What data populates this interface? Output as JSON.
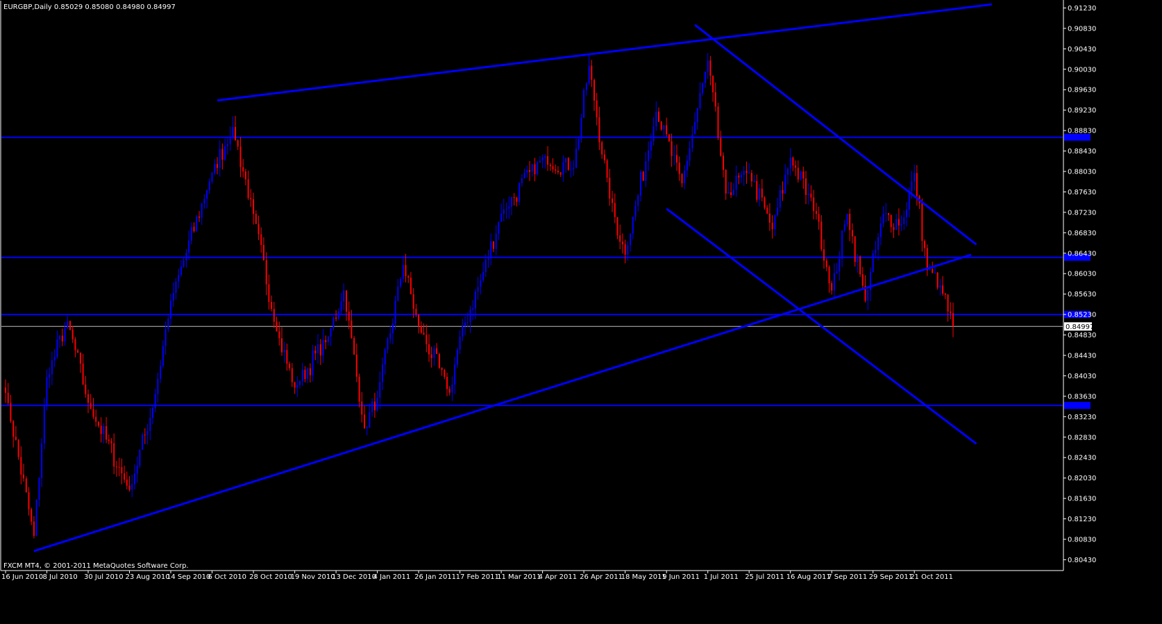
{
  "window": {
    "symbol_header": "EURGBP,Daily  0.85029 0.85080 0.84980 0.84997",
    "copyright": "FXCM MT4, © 2001-2011 MetaQuotes Software Corp."
  },
  "chart_data": {
    "type": "candlestick",
    "symbol": "EURGBP",
    "timeframe": "Daily",
    "ohlc_last": {
      "open": 0.85029,
      "high": 0.8508,
      "low": 0.8498,
      "close": 0.84997
    },
    "current_price_label": "0.84997",
    "ylim": [
      0.803,
      0.9133
    ],
    "y_ticks": [
      "0.91230",
      "0.90830",
      "0.90430",
      "0.90030",
      "0.89630",
      "0.89230",
      "0.88830",
      "0.88430",
      "0.88030",
      "0.87630",
      "0.87230",
      "0.86830",
      "0.86430",
      "0.86030",
      "0.85630",
      "0.85230",
      "0.84830",
      "0.84430",
      "0.84030",
      "0.83630",
      "0.83230",
      "0.82830",
      "0.82430",
      "0.82030",
      "0.81630",
      "0.81230",
      "0.80830",
      "0.80430"
    ],
    "x_labels": [
      "16 Jun 2010",
      "8 Jul 2010",
      "30 Jul 2010",
      "23 Aug 2010",
      "14 Sep 2010",
      "6 Oct 2010",
      "28 Oct 2010",
      "19 Nov 2010",
      "13 Dec 2010",
      "4 Jan 2011",
      "26 Jan 2011",
      "17 Feb 2011",
      "11 Mar 2011",
      "4 Apr 2011",
      "26 Apr 2011",
      "18 May 2011",
      "9 Jun 2011",
      "1 Jul 2011",
      "25 Jul 2011",
      "16 Aug 2011",
      "7 Sep 2011",
      "29 Sep 2011",
      "21 Oct 2011"
    ],
    "key_closes": [
      {
        "date": "16 Jun 2010",
        "close": 0.837
      },
      {
        "date": "1 Jul 2010",
        "close": 0.809
      },
      {
        "date": "8 Jul 2010",
        "close": 0.84
      },
      {
        "date": "20 Jul 2010",
        "close": 0.851
      },
      {
        "date": "30 Jul 2010",
        "close": 0.835
      },
      {
        "date": "23 Aug 2010",
        "close": 0.818
      },
      {
        "date": "5 Sep 2010",
        "close": 0.834
      },
      {
        "date": "14 Sep 2010",
        "close": 0.855
      },
      {
        "date": "6 Oct 2010",
        "close": 0.88
      },
      {
        "date": "18 Oct 2010",
        "close": 0.889
      },
      {
        "date": "28 Oct 2010",
        "close": 0.872
      },
      {
        "date": "10 Nov 2010",
        "close": 0.849
      },
      {
        "date": "19 Nov 2010",
        "close": 0.838
      },
      {
        "date": "8 Dec 2010",
        "close": 0.848
      },
      {
        "date": "16 Dec 2010",
        "close": 0.857
      },
      {
        "date": "28 Dec 2010",
        "close": 0.83
      },
      {
        "date": "4 Jan 2011",
        "close": 0.836
      },
      {
        "date": "18 Jan 2011",
        "close": 0.862
      },
      {
        "date": "26 Jan 2011",
        "close": 0.85
      },
      {
        "date": "12 Feb 2011",
        "close": 0.837
      },
      {
        "date": "17 Feb 2011",
        "close": 0.848
      },
      {
        "date": "1 Mar 2011",
        "close": 0.859
      },
      {
        "date": "11 Mar 2011",
        "close": 0.872
      },
      {
        "date": "4 Apr 2011",
        "close": 0.883
      },
      {
        "date": "20 Apr 2011",
        "close": 0.881
      },
      {
        "date": "28 Apr 2011",
        "close": 0.901
      },
      {
        "date": "10 May 2011",
        "close": 0.875
      },
      {
        "date": "18 May 2011",
        "close": 0.864
      },
      {
        "date": "5 Jun 2011",
        "close": 0.892
      },
      {
        "date": "17 Jun 2011",
        "close": 0.878
      },
      {
        "date": "1 Jul 2011",
        "close": 0.902
      },
      {
        "date": "12 Jul 2011",
        "close": 0.876
      },
      {
        "date": "25 Jul 2011",
        "close": 0.88
      },
      {
        "date": "5 Aug 2011",
        "close": 0.869
      },
      {
        "date": "16 Aug 2011",
        "close": 0.883
      },
      {
        "date": "30 Aug 2011",
        "close": 0.872
      },
      {
        "date": "7 Sep 2011",
        "close": 0.857
      },
      {
        "date": "15 Sep 2011",
        "close": 0.872
      },
      {
        "date": "26 Sep 2011",
        "close": 0.855
      },
      {
        "date": "5 Oct 2011",
        "close": 0.872
      },
      {
        "date": "14 Oct 2011",
        "close": 0.87
      },
      {
        "date": "21 Oct 2011",
        "close": 0.88
      },
      {
        "date": "28 Oct 2011",
        "close": 0.861
      },
      {
        "date": "4 Nov 2011",
        "close": 0.858
      },
      {
        "date": "11 Nov 2011",
        "close": 0.85
      }
    ],
    "horizontal_levels": [
      0.887,
      0.8635,
      0.8523,
      0.8345
    ],
    "trendlines": [
      {
        "name": "upper-resistance-line",
        "from": {
          "date": "10 Oct 2010",
          "price": 0.8942
        },
        "to": {
          "date": "4 Dec 2011",
          "price": 0.913
        }
      },
      {
        "name": "rising-support-line",
        "from": {
          "date": "1 Jul 2010",
          "price": 0.806
        },
        "to": {
          "date": "22 Nov 2011",
          "price": 0.864
        }
      },
      {
        "name": "channel-top-line",
        "from": {
          "date": "26 Jun 2011",
          "price": 0.909
        },
        "to": {
          "date": "24 Nov 2011",
          "price": 0.866
        }
      },
      {
        "name": "channel-bottom-line",
        "from": {
          "date": "9 Jun 2011",
          "price": 0.873
        },
        "to": {
          "date": "24 Nov 2011",
          "price": 0.827
        }
      }
    ],
    "colors": {
      "background": "#000000",
      "bull_candle": "#0000ff",
      "bear_candle": "#ff0000",
      "lines": "#0000ff",
      "text": "#ffffff",
      "axis": "#ffffff"
    }
  }
}
